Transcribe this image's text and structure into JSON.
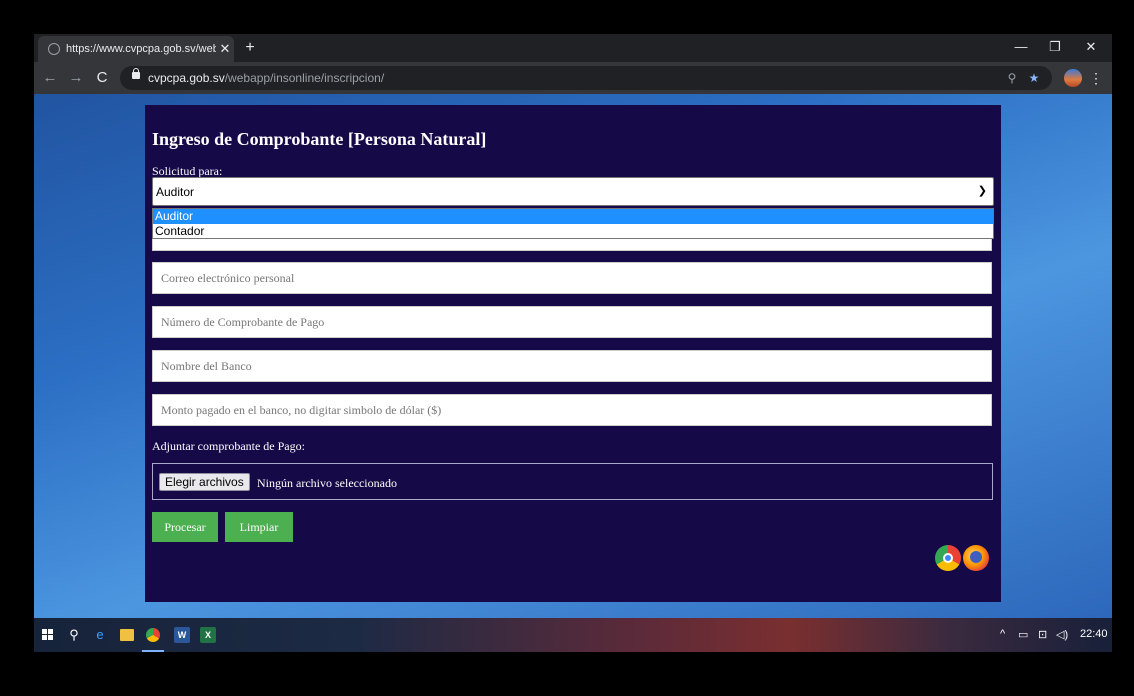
{
  "browser": {
    "tab_title": "https://www.cvpcpa.gob.sv/weba",
    "url_domain": "cvpcpa.gob.sv",
    "url_path": "/webapp/insonline/inscripcion/"
  },
  "form": {
    "title": "Ingreso de Comprobante [Persona Natural]",
    "solicitud_label": "Solicitud para:",
    "solicitud_value": "Auditor",
    "solicitud_options": [
      "Auditor",
      "Contador"
    ],
    "email_placeholder": "Correo electrónico personal",
    "comprobante_placeholder": "Número de Comprobante de Pago",
    "banco_placeholder": "Nombre del Banco",
    "monto_placeholder": "Monto pagado en el banco, no digitar simbolo de dólar ($)",
    "adjuntar_label": "Adjuntar comprobante de Pago:",
    "file_button": "Elegir archivos",
    "file_status": "Ningún archivo seleccionado",
    "procesar_label": "Procesar",
    "limpiar_label": "Limpiar"
  },
  "taskbar": {
    "time": "22:40"
  },
  "colors": {
    "page_bg": "#150947",
    "button_green": "#4caf50",
    "option_highlight": "#1e90ff"
  }
}
